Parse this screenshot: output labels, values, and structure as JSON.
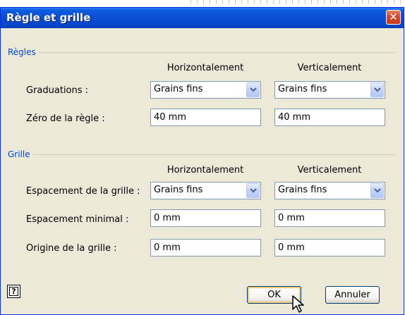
{
  "dialog": {
    "title": "Règle et grille"
  },
  "rules": {
    "group_label": "Règles",
    "col_horizontal": "Horizontalement",
    "col_vertical": "Verticalement",
    "graduations": {
      "label": "Graduations :",
      "horizontal": "Grains fins",
      "vertical": "Grains fins"
    },
    "zero": {
      "label": "Zéro de la règle :",
      "horizontal": "40 mm",
      "vertical": "40 mm"
    }
  },
  "grid": {
    "group_label": "Grille",
    "col_horizontal": "Horizontalement",
    "col_vertical": "Verticalement",
    "spacing": {
      "label": "Espacement de la grille :",
      "horizontal": "Grains fins",
      "vertical": "Grains fins"
    },
    "min_spacing": {
      "label": "Espacement minimal :",
      "horizontal": "0 mm",
      "vertical": "0 mm"
    },
    "origin": {
      "label": "Origine de la grille :",
      "horizontal": "0 mm",
      "vertical": "0 mm"
    }
  },
  "buttons": {
    "help": "?",
    "ok": "OK",
    "cancel": "Annuler"
  },
  "icons": {
    "close": "close-icon",
    "dropdown": "chevron-down-icon",
    "help": "help-icon",
    "cursor": "mouse-pointer-icon"
  },
  "colors": {
    "titlebar": "#0a4fd4",
    "group_label": "#0046d5",
    "dialog_bg": "#ece9d8",
    "close": "#d7452a"
  }
}
